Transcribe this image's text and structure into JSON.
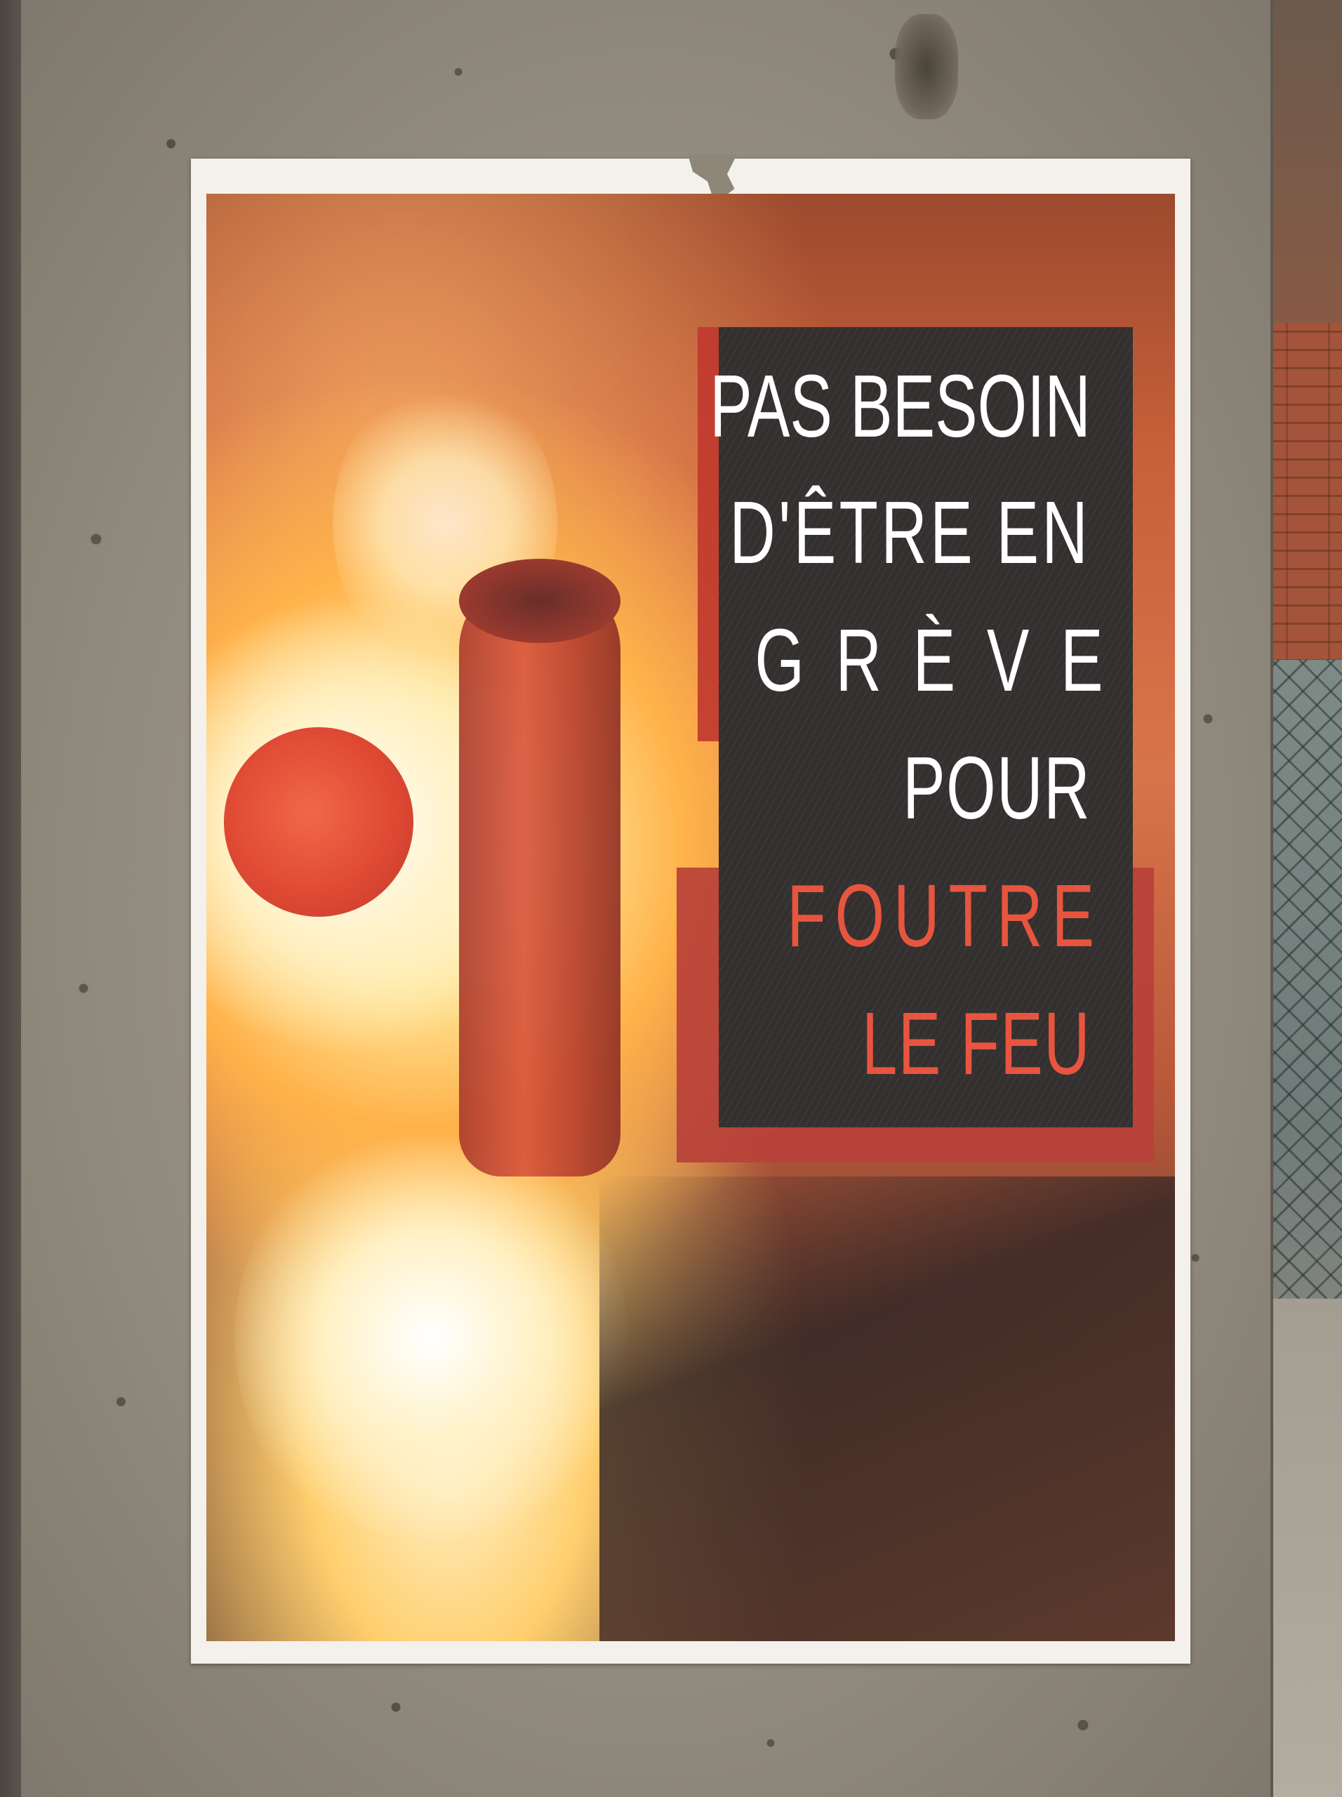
{
  "poster": {
    "slogan_lines": [
      "PAS BESOIN",
      "D'ÊTRE EN",
      "GRÈVE",
      "POUR",
      "FOUTRE",
      "LE FEU"
    ],
    "colors": {
      "text_primary": "#ffffff",
      "text_accent": "#e8553f",
      "panel_dark": "#34302f",
      "panel_red": "#b8413a",
      "paper": "#f4f1ec",
      "concrete": "#958e82"
    }
  }
}
